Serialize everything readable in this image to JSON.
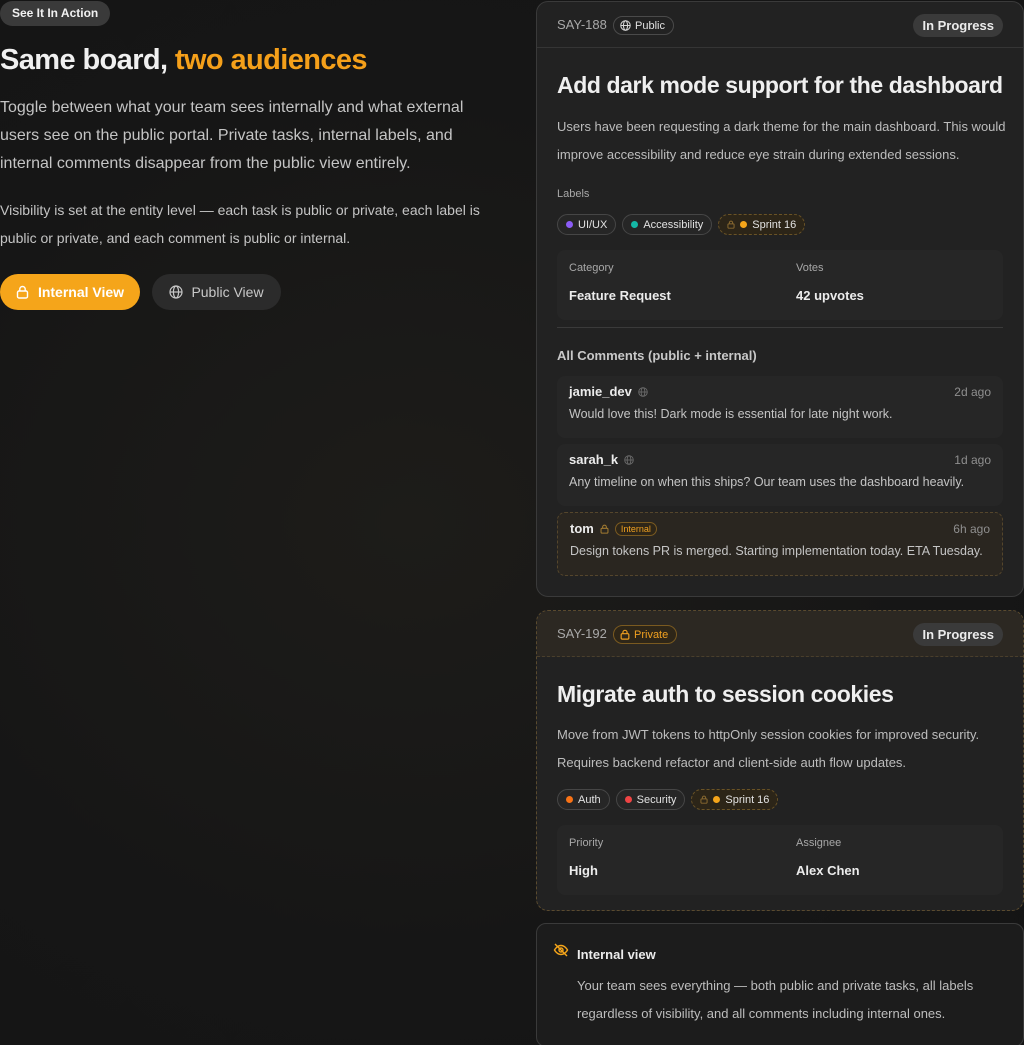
{
  "intro": {
    "tag": "See It In Action",
    "headline_main": "Same board, ",
    "headline_accent": "two audiences",
    "lead": "Toggle between what your team sees internally and what external users see on the public portal. Private tasks, internal labels, and internal comments disappear from the public view entirely.",
    "detail": "Visibility is set at the entity level — each task is public or private, each label is public or private, and each comment is public or internal."
  },
  "toggle": {
    "internal_label": "Internal View",
    "public_label": "Public View",
    "active": "internal"
  },
  "colors": {
    "accent": "#f5a51a",
    "purple": "#8b5cf6",
    "teal": "#14b8a6",
    "orange": "#f97316",
    "red": "#ef4444",
    "amber": "#f5a51a"
  },
  "card1": {
    "id": "SAY-188",
    "visibility": "Public",
    "status": "In Progress",
    "title": "Add dark mode support for the dashboard",
    "description": "Users have been requesting a dark theme for the main dashboard. This would improve accessibility and reduce eye strain during extended sessions.",
    "labels_heading": "Labels",
    "labels": [
      {
        "name": "UI/UX",
        "color": "purple",
        "internal": false
      },
      {
        "name": "Accessibility",
        "color": "teal",
        "internal": false
      },
      {
        "name": "Sprint 16",
        "color": "amber",
        "internal": true
      }
    ],
    "meta": [
      {
        "label": "Category",
        "value": "Feature Request"
      },
      {
        "label": "Votes",
        "value": "42 upvotes"
      }
    ],
    "comments_heading": "All Comments (public + internal)",
    "comments": [
      {
        "author": "jamie_dev",
        "time": "2d ago",
        "text": "Would love this! Dark mode is essential for late night work.",
        "internal": false
      },
      {
        "author": "sarah_k",
        "time": "1d ago",
        "text": "Any timeline on when this ships? Our team uses the dashboard heavily.",
        "internal": false
      },
      {
        "author": "tom",
        "tag": "Internal",
        "time": "6h ago",
        "text": "Design tokens PR is merged. Starting implementation today. ETA Tuesday.",
        "internal": true
      }
    ]
  },
  "card2": {
    "id": "SAY-192",
    "visibility": "Private",
    "status": "In Progress",
    "title": "Migrate auth to session cookies",
    "description": "Move from JWT tokens to httpOnly session cookies for improved security. Requires backend refactor and client-side auth flow updates.",
    "labels": [
      {
        "name": "Auth",
        "color": "orange",
        "internal": false
      },
      {
        "name": "Security",
        "color": "red",
        "internal": false
      },
      {
        "name": "Sprint 16",
        "color": "amber",
        "internal": true
      }
    ],
    "meta": [
      {
        "label": "Priority",
        "value": "High"
      },
      {
        "label": "Assignee",
        "value": "Alex Chen"
      }
    ]
  },
  "info": {
    "title": "Internal view",
    "text": "Your team sees everything — both public and private tasks, all labels regardless of visibility, and all comments including internal ones."
  }
}
